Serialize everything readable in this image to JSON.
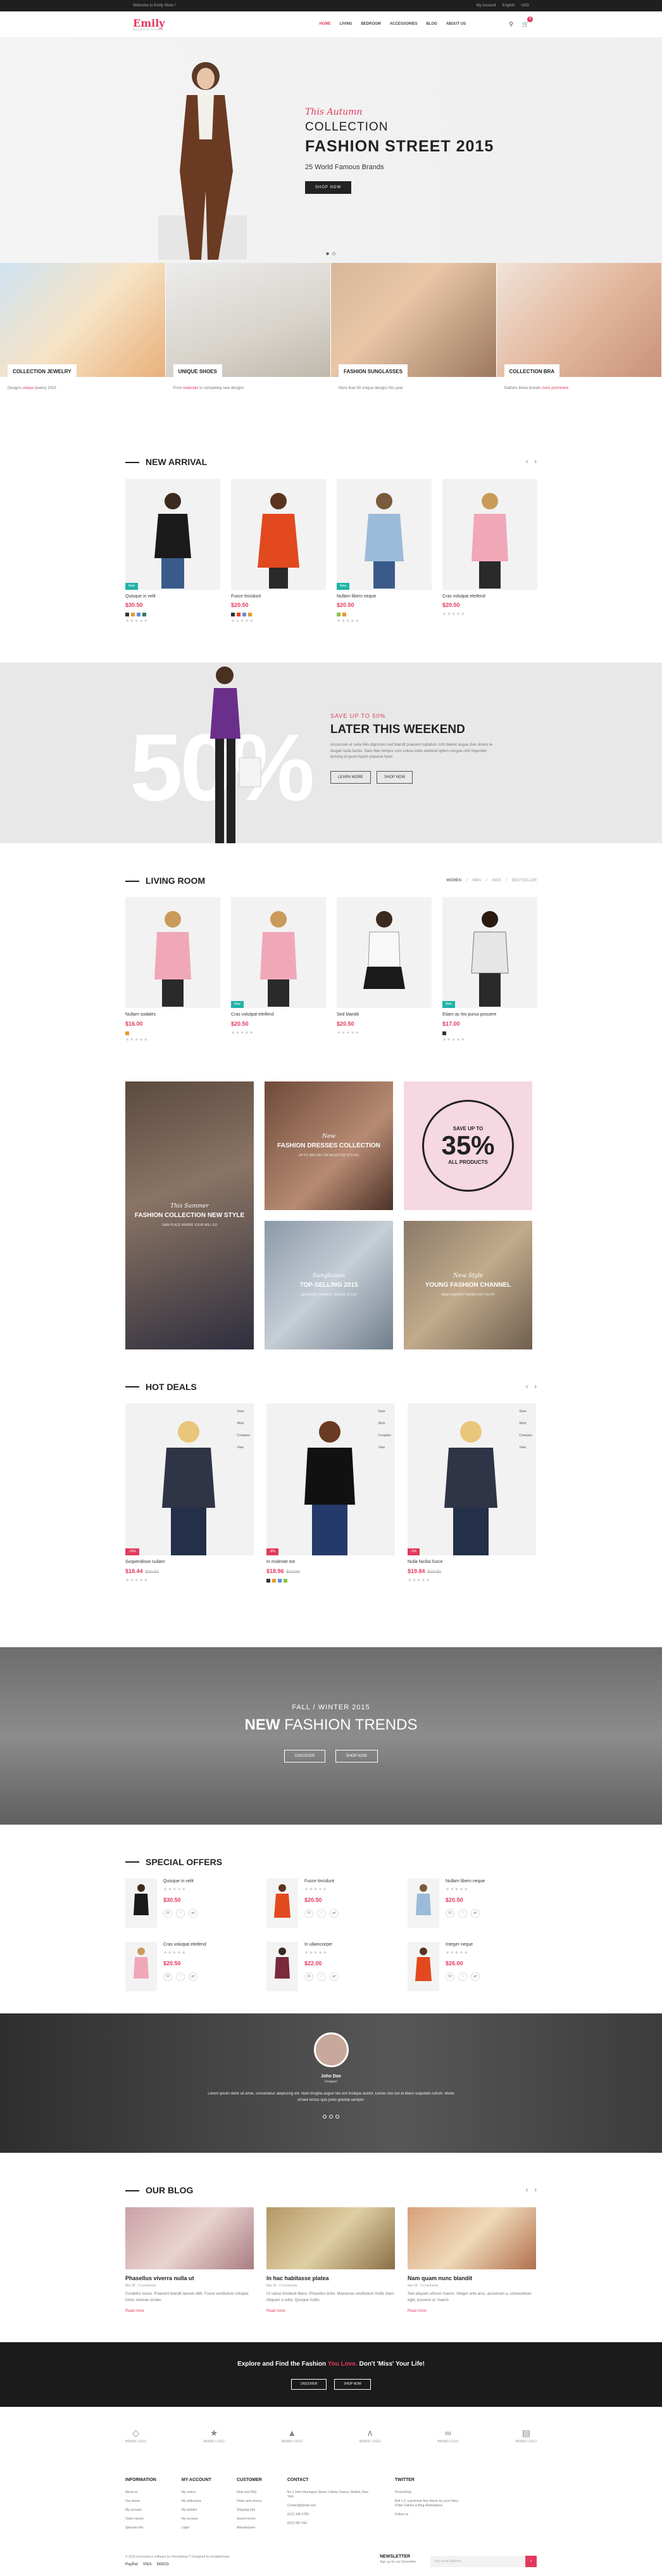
{
  "topbar": {
    "welcome": "Welcome to Emily Store !",
    "account": "My Account",
    "language": "English",
    "currency": "USD"
  },
  "brand": {
    "name": "Emily",
    "tagline": "FASHION STORE",
    "accent": "#e23a5d"
  },
  "nav": {
    "items": [
      "HOME",
      "LIVING",
      "BEDROOM",
      "ACCESSORIES",
      "BLOG",
      "ABOUT US"
    ],
    "active": "HOME",
    "cart_count": "0"
  },
  "hero": {
    "script": "This Autumn",
    "line1": "COLLECTION",
    "line2": "FASHION STREET 2015",
    "line3": "25 World Famous Brands",
    "button": "SHOP NOW"
  },
  "categories": [
    {
      "label": "COLLECTION JEWELRY",
      "desc_pre": "Designs ",
      "desc_em": "unique",
      "desc_post": " jewelry 2015"
    },
    {
      "label": "UNIQUE SHOES",
      "desc_pre": "From ",
      "desc_em": "materials",
      "desc_post": " to completely new designs"
    },
    {
      "label": "FASHION SUNGLASSES",
      "desc_pre": "More than 50 unique designs this year",
      "desc_em": "",
      "desc_post": ""
    },
    {
      "label": "COLLECTION BRA",
      "desc_pre": "Gathers these brands ",
      "desc_em": "more prominent",
      "desc_post": ""
    }
  ],
  "new_arrival": {
    "title": "NEW ARRIVAL",
    "products": [
      {
        "name": "Quisque in velit",
        "price": "$30.50",
        "badge": "New"
      },
      {
        "name": "Fusce tincidunt",
        "price": "$20.50",
        "badge": ""
      },
      {
        "name": "Nullam libero neque",
        "price": "$20.50",
        "badge": "New"
      },
      {
        "name": "Cras volutpat eleifend",
        "price": "$20.50",
        "badge": ""
      }
    ]
  },
  "promo": {
    "big": "50%",
    "kicker": "SAVE UP TO 50%",
    "title": "LATER THIS WEEKEND",
    "body": "Accumsan et nulla felis dignissim sed blandit praesent luptatum zzril delenit augue duis dolore te feugait nulla facilisi. Nam liber tempor cum soluta nobis eleifend option congue nihil imperdiet doming id quod mazim placerat facer.",
    "btn1": "LEARN MORE",
    "btn2": "SHOP NOW"
  },
  "living": {
    "title": "LIVING ROOM",
    "tabs": [
      "WOMEN",
      "MEN",
      "KIDS",
      "BESTSELLER"
    ],
    "products": [
      {
        "name": "Nullam sodales",
        "price": "$16.00",
        "badge": ""
      },
      {
        "name": "Cras volutpat eleifend",
        "price": "$20.50",
        "badge": "New"
      },
      {
        "name": "Sed blandit",
        "price": "$20.50",
        "badge": ""
      },
      {
        "name": "Etiam ac leo purus posuere",
        "price": "$17.00",
        "badge": "New"
      }
    ]
  },
  "mosaic": {
    "t1": {
      "script": "New",
      "title": "FASHION DRESSES COLLECTION",
      "sub": "UP TO 40% OFF ON SELECTED STYLES"
    },
    "t2": {
      "script": "This Summer",
      "title": "FASHION COLLECTION NEW STYLE",
      "sub": "GAIN PLACE WHERE YOUR WILL GO"
    },
    "t3": {
      "a": "SAVE UP TO",
      "b": "35%",
      "c": "ALL PRODUCTS"
    },
    "t4": {
      "script": "Sunglasses",
      "title": "TOP-SELLING 2015",
      "sub": "SPEAKING SAVINGS TRENDS STYLE"
    },
    "t5": {
      "script": "New Style",
      "title": "YOUNG FASHION CHANNEL",
      "sub": "NEW FASHION TREND FOR YOUTH"
    }
  },
  "hot": {
    "title": "HOT DEALS",
    "side": [
      "Save",
      "Wish",
      "Compare",
      "View"
    ],
    "products": [
      {
        "name": "Suspendisse nullam",
        "price": "$18.44",
        "old": "$20.50",
        "badge": "-15%"
      },
      {
        "name": "In molestie est",
        "price": "$18.96",
        "old": "$20.50",
        "badge": "-8%"
      },
      {
        "name": "Nulla facilisi fusce",
        "price": "$19.84",
        "old": "$20.50",
        "badge": "-3%"
      }
    ]
  },
  "fashion": {
    "line1": "FALL / WINTER 2015",
    "line2_b": "NEW",
    "line2": " FASHION TRENDS",
    "btn1": "DISCOVER",
    "btn2": "SHOP NOW"
  },
  "offers": {
    "title": "SPECIAL OFFERS",
    "items": [
      {
        "name": "Quisque in velit",
        "price": "$30.50"
      },
      {
        "name": "Fusce tincidunt",
        "price": "$20.50"
      },
      {
        "name": "Nullam libero neque",
        "price": "$20.50"
      },
      {
        "name": "Cras volutpat eleifend",
        "price": "$20.50"
      },
      {
        "name": "In ullamcorper",
        "price": "$22.00"
      },
      {
        "name": "Integer neque",
        "price": "$26.00"
      }
    ]
  },
  "testimonial": {
    "name": "John Doe",
    "role": "Designer",
    "quote": "Lorem ipsum dolor sit amet, consectetur adipiscing elit. Nam fringilla augue nec est tristique auctor. Donec non est at libero vulputate rutrum. Morbi ornare lectus quis justo gravida semper."
  },
  "blog": {
    "title": "OUR BLOG",
    "posts": [
      {
        "title": "Phasellus viverra nulla ut",
        "meta": "Mar 28 · 0 Comments",
        "body": "Curabitur luctus. Praesent blandit laoreet nibh. Fusce vestibulum volutpat tortor. Aenean ornare.",
        "more": "Read more"
      },
      {
        "title": "In hac habitasse platea",
        "meta": "Mar 28 · 0 Comments",
        "body": "Ut varius tincidunt libero. Phasellus dolor. Maecenas vestibulum mollis diam. Aliquam a nulla. Quisque mollis.",
        "more": "Read more"
      },
      {
        "title": "Nam quam nunc blandit",
        "meta": "Mar 28 · 0 Comments",
        "body": "Sed aliquam ultrices mauris. Integer ante arcu, accumsan a, consectetuer eget, posuere ut, mauris.",
        "more": "Read more"
      }
    ]
  },
  "cta": {
    "pre": "Explore and Find the Fashion ",
    "em": "You Love.",
    "post": " Don't 'Miss' Your Life!",
    "btn1": "DISCOVER",
    "btn2": "SHOP NOW"
  },
  "brands": [
    "BRAND LOGO",
    "BRAND LOGO",
    "BRAND LOGO",
    "BRAND LOGO",
    "BRAND LOGO",
    "BRAND LOGO"
  ],
  "footer": {
    "info": {
      "title": "INFORMATION",
      "items": [
        "About us",
        "Our stores",
        "My account",
        "Order history",
        "Specials info"
      ]
    },
    "account": {
      "title": "MY ACCOUNT",
      "items": [
        "My orders",
        "My addresses",
        "My wishlist",
        "My account",
        "Login"
      ]
    },
    "customer": {
      "title": "CUSTOMER",
      "items": [
        "Help and FAQ",
        "Order and returns",
        "Shipping Info",
        "Search terms",
        "Manufacturer"
      ]
    },
    "contact": {
      "title": "CONTACT",
      "items": [
        "No 1 John Harrington Street, Liberty Towers, Madrid, New York",
        "Contact@gmail.com",
        "(012) 345 6789",
        "(012) 987 654"
      ]
    },
    "twitter": {
      "title": "TWITTER",
      "handle": "PrestaShop",
      "text": "Bell 1.2: a premium free theme for your Harry Potter Gallery & Blog Marketplace",
      "link": "Follow us"
    }
  },
  "bottom": {
    "copy": "© 2015 Ecommerce software by PrestaShop™ Designed by templatemela",
    "pays": [
      "PayPal",
      "VISA",
      "DISCO"
    ]
  },
  "newsletter": {
    "title": "NEWSLETTER",
    "sub": "Sign up for our Newsletter",
    "placeholder": "Your email address"
  }
}
